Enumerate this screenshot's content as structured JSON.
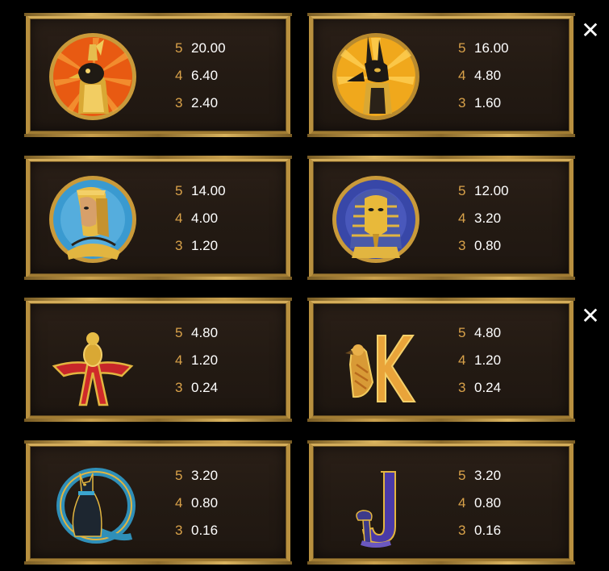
{
  "close_icon_glyph": "✕",
  "symbols": [
    {
      "name": "horus",
      "pays": [
        {
          "count": "5",
          "value": "20.00"
        },
        {
          "count": "4",
          "value": "6.40"
        },
        {
          "count": "3",
          "value": "2.40"
        }
      ]
    },
    {
      "name": "anubis",
      "pays": [
        {
          "count": "5",
          "value": "16.00"
        },
        {
          "count": "4",
          "value": "4.80"
        },
        {
          "count": "3",
          "value": "1.60"
        }
      ]
    },
    {
      "name": "cleopatra",
      "pays": [
        {
          "count": "5",
          "value": "14.00"
        },
        {
          "count": "4",
          "value": "4.00"
        },
        {
          "count": "3",
          "value": "1.20"
        }
      ]
    },
    {
      "name": "pharaoh",
      "pays": [
        {
          "count": "5",
          "value": "12.00"
        },
        {
          "count": "4",
          "value": "3.20"
        },
        {
          "count": "3",
          "value": "0.80"
        }
      ]
    },
    {
      "name": "A",
      "pays": [
        {
          "count": "5",
          "value": "4.80"
        },
        {
          "count": "4",
          "value": "1.20"
        },
        {
          "count": "3",
          "value": "0.24"
        }
      ]
    },
    {
      "name": "K",
      "pays": [
        {
          "count": "5",
          "value": "4.80"
        },
        {
          "count": "4",
          "value": "1.20"
        },
        {
          "count": "3",
          "value": "0.24"
        }
      ]
    },
    {
      "name": "Q",
      "pays": [
        {
          "count": "5",
          "value": "3.20"
        },
        {
          "count": "4",
          "value": "0.80"
        },
        {
          "count": "3",
          "value": "0.16"
        }
      ]
    },
    {
      "name": "J",
      "pays": [
        {
          "count": "5",
          "value": "3.20"
        },
        {
          "count": "4",
          "value": "0.80"
        },
        {
          "count": "3",
          "value": "0.16"
        }
      ]
    }
  ]
}
